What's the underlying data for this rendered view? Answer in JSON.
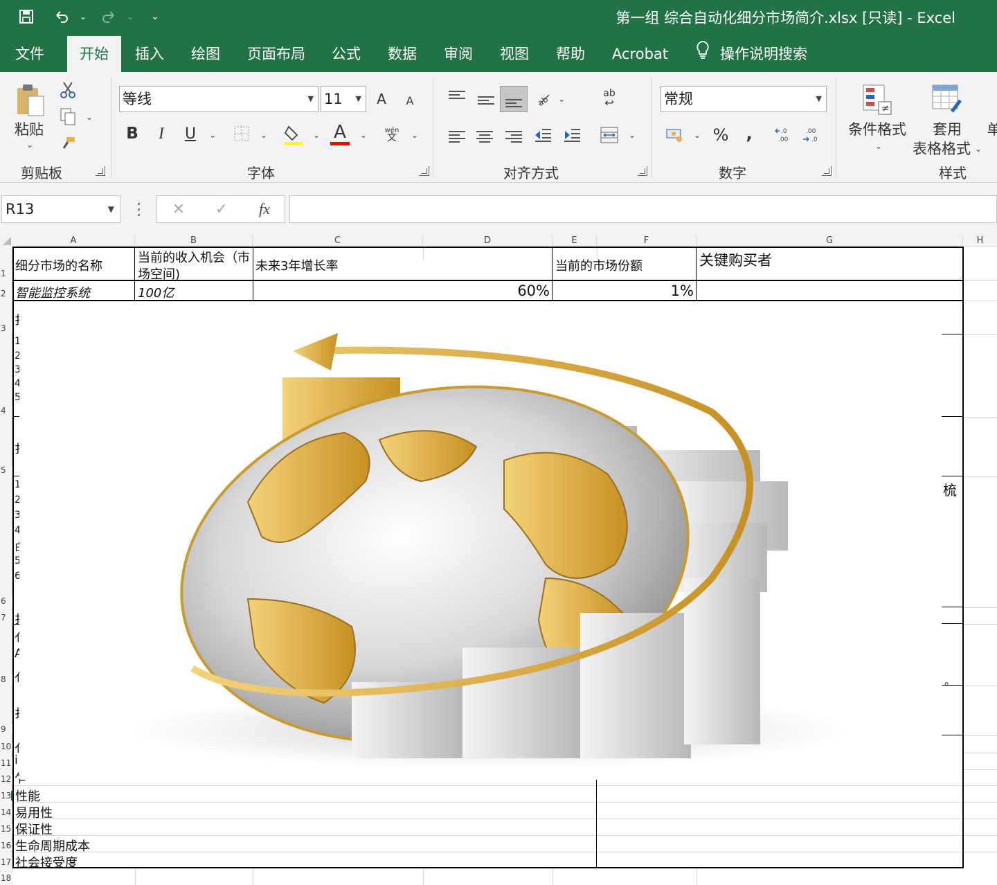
{
  "title_bar": {
    "save_icon": "save-icon",
    "undo_icon": "undo-icon",
    "redo_icon": "redo-icon",
    "title": "第一组 综合自动化细分市场简介.xlsx  [只读]  -  Excel"
  },
  "tabs": [
    "文件",
    "开始",
    "插入",
    "绘图",
    "页面布局",
    "公式",
    "数据",
    "审阅",
    "视图",
    "帮助",
    "Acrobat",
    "操作说明搜索"
  ],
  "active_tab": "开始",
  "ribbon": {
    "clipboard": {
      "paste_label": "粘贴",
      "group_label": "剪贴板"
    },
    "font": {
      "font_name": "等线",
      "font_size": "11",
      "bold": "B",
      "italic": "I",
      "underline": "U",
      "grow": "A",
      "shrink": "A",
      "font_color_letter": "A",
      "phonetic_top": "wén",
      "phonetic_bottom": "文",
      "group_label": "字体"
    },
    "alignment": {
      "orientation_glyph": "ab",
      "group_label": "对齐方式"
    },
    "number": {
      "format": "常规",
      "percent": "%",
      "comma": ",",
      "group_label": "数字"
    },
    "styles": {
      "conditional_format": "条件格式",
      "table_format_1": "套用",
      "table_format_2": "表格格式",
      "cell_styles_fragment": "单",
      "group_label": "样式"
    }
  },
  "formula_bar": {
    "name_box": "R13",
    "fx": "fx",
    "formula": ""
  },
  "columns": [
    "A",
    "B",
    "C",
    "D",
    "E",
    "F",
    "G",
    "H"
  ],
  "rows": [
    "1",
    "2",
    "3",
    "4",
    "5",
    "6",
    "7",
    "8",
    "9",
    "10",
    "11",
    "12",
    "13",
    "14",
    "15",
    "16",
    "17",
    "18"
  ],
  "cells": {
    "a1": "细分市场的名称",
    "b1_line1": "当前的收入机会（市",
    "b1_line2": "场空间)",
    "c1": "未来3年增长率",
    "e1": "当前的市场份额",
    "g1": "关键购买者",
    "a2": "智能监控系统",
    "b2": "100亿",
    "d2": "60%",
    "f2": "1%",
    "a13": "性能",
    "a14": "易用性",
    "a15": "保证性",
    "a16": "生命周期成本",
    "a17": "社会接受度",
    "right_fragment_1": "梳",
    "right_fragment_2": "。"
  },
  "left_fragments": [
    "扌",
    "1",
    "2",
    "3",
    "4",
    "5",
    "扌",
    "1",
    "2",
    "3",
    "4",
    "白",
    "5",
    "6",
    "扌",
    "亻",
    "A",
    "亻",
    "扌",
    "亻",
    "i",
    "乍"
  ],
  "image": {
    "name": "globe-growth-image"
  },
  "colors": {
    "excel_green": "#217346",
    "ribbon_bg": "#f3f3f3",
    "gold": "#e3b34a",
    "yellow_hilite": "#ffff00",
    "red_font": "#ff0000"
  }
}
